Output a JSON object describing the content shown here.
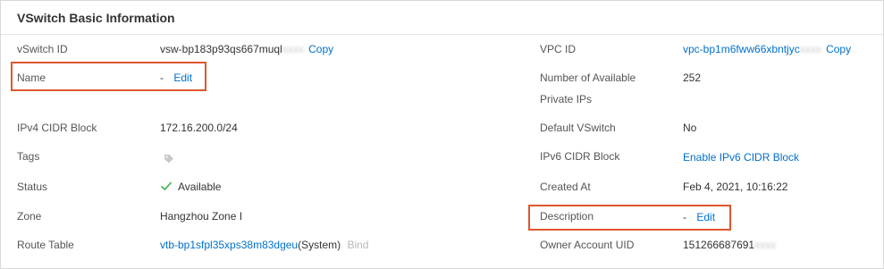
{
  "panel": {
    "title": "VSwitch Basic Information"
  },
  "left": {
    "vswitch_id": {
      "label": "vSwitch ID",
      "value": "vsw-bp183p93qs667muql",
      "value_masked": "xxxx",
      "action": "Copy"
    },
    "name": {
      "label": "Name",
      "value": "-",
      "action": "Edit"
    },
    "ipv4": {
      "label": "IPv4 CIDR Block",
      "value": "172.16.200.0/24"
    },
    "tags": {
      "label": "Tags",
      "icon": "tag-icon"
    },
    "status": {
      "label": "Status",
      "value": "Available",
      "icon": "check-icon"
    },
    "zone": {
      "label": "Zone",
      "value": "Hangzhou Zone I"
    },
    "route_table": {
      "label": "Route Table",
      "value": "vtb-bp1sfpl35xps38m83dgeu",
      "suffix": "(System)",
      "action": "Bind"
    }
  },
  "right": {
    "vpc_id": {
      "label": "VPC ID",
      "value": "vpc-bp1m6fww66xbntjyc",
      "value_masked": "xxxx",
      "action": "Copy"
    },
    "available_ips": {
      "label_line1": "Number of Available",
      "label_line2": "Private IPs",
      "value": "252"
    },
    "default_vswitch": {
      "label": "Default VSwitch",
      "value": "No"
    },
    "ipv6": {
      "label": "IPv6 CIDR Block",
      "action": "Enable IPv6 CIDR Block"
    },
    "created_at": {
      "label": "Created At",
      "value": "Feb 4, 2021, 10:16:22"
    },
    "description": {
      "label": "Description",
      "value": "-",
      "action": "Edit"
    },
    "owner_uid": {
      "label": "Owner Account UID",
      "value": "151266687691",
      "value_masked": "xxxx"
    }
  },
  "colors": {
    "link": "#0070cc",
    "highlight": "#e0552f",
    "success": "#3bb346"
  }
}
